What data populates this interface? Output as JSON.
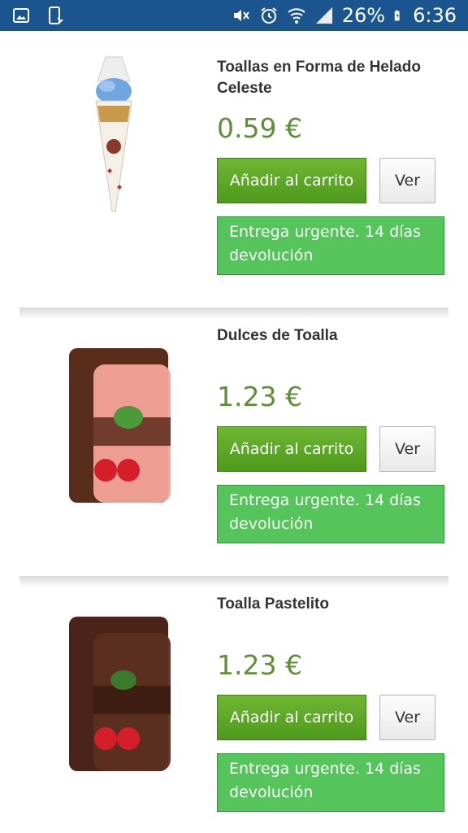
{
  "status_bar": {
    "battery": "26%",
    "time": "6:36",
    "icons_left": [
      "image-icon",
      "phone-download-icon"
    ],
    "icons_right": [
      "mute-icon",
      "alarm-icon",
      "wifi-icon",
      "signal-icon",
      "battery-icon"
    ]
  },
  "products": [
    {
      "title": "Toallas en Forma de Helado Celeste",
      "price": "0.59 €",
      "add_label": "Añadir al carrito",
      "view_label": "Ver",
      "notice": "Entrega urgente. 14 días devolución",
      "image": "ice-cream-cone-towel-image"
    },
    {
      "title": "Dulces de Toalla",
      "price": "1.23 €",
      "add_label": "Añadir al carrito",
      "view_label": "Ver",
      "notice": "Entrega urgente. 14 días devolución",
      "image": "pink-cake-towel-image"
    },
    {
      "title": "Toalla Pastelito",
      "price": "1.23 €",
      "add_label": "Añadir al carrito",
      "view_label": "Ver",
      "notice": "Entrega urgente. 14 días devolución",
      "image": "chocolate-cake-towel-image"
    }
  ],
  "colors": {
    "status_bar": "#1a5590",
    "price": "#5e8f34",
    "cart_button": "#5aa827",
    "notice": "#55c45a"
  }
}
